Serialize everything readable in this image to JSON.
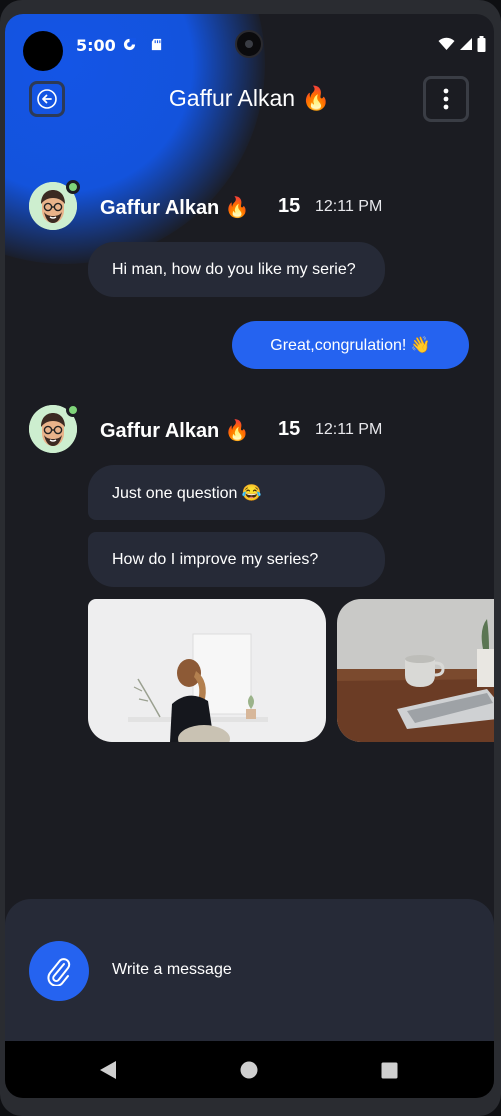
{
  "status_bar": {
    "time": "5:00"
  },
  "header": {
    "title": "Gaffur Alkan 🔥"
  },
  "messages": {
    "group1": {
      "sender": "Gaffur Alkan 🔥",
      "count": "15",
      "time": "12:11 PM",
      "bubbles": [
        "Hi man, how do you like my serie?"
      ]
    },
    "outgoing": {
      "text": "Great,congrulation! 👋"
    },
    "group2": {
      "sender": "Gaffur Alkan 🔥",
      "count": "15",
      "time": "12:11 PM",
      "bubbles": [
        "Just one question 😂",
        "How do I improve my series?"
      ]
    }
  },
  "composer": {
    "placeholder": "Write a message"
  },
  "colors": {
    "accent": "#2563f0",
    "background": "#1b1c22",
    "bubble": "#262a37",
    "online": "#7fd47a"
  },
  "icons": [
    "back-arrow-icon",
    "more-vert-icon",
    "paperclip-icon",
    "wifi-icon",
    "signal-icon",
    "battery-icon"
  ]
}
